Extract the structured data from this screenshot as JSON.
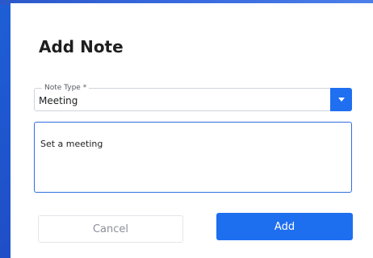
{
  "modal": {
    "title": "Add Note"
  },
  "note_type": {
    "label": "Note Type *",
    "value": "Meeting"
  },
  "note_text": {
    "value": "Set a meeting"
  },
  "actions": {
    "cancel_label": "Cancel",
    "add_label": "Add"
  },
  "colors": {
    "primary": "#1e6ef0",
    "backdrop": "#1f4fc8"
  },
  "icons": {
    "dropdown": "chevron-down-icon"
  }
}
